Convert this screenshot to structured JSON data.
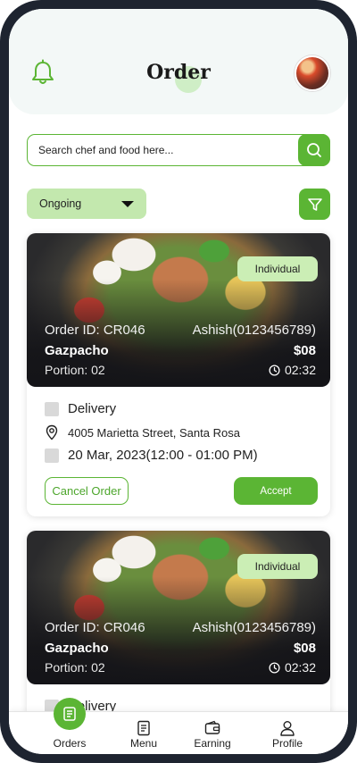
{
  "header": {
    "title": "Order",
    "icons": {
      "left": "bell-icon",
      "right": "avatar"
    }
  },
  "search": {
    "placeholder": "Search chef and food here...",
    "icon": "search-icon"
  },
  "filters": {
    "status_selected": "Ongoing",
    "filter_icon": "filter-icon"
  },
  "orders": [
    {
      "type": "Individual",
      "order_id": "Order ID: CR046",
      "customer": "Ashish(0123456789)",
      "dish": "Gazpacho",
      "price": "$08",
      "portion": "Portion: 02",
      "timer": "02:32",
      "delivery_label": "Delivery",
      "address": "4005 Marietta Street, Santa Rosa",
      "date": "20 Mar, 2023(12:00 - 01:00 PM)",
      "cancel_label": "Cancel Order",
      "accept_label": "Accept"
    },
    {
      "type": "Individual",
      "order_id": "Order ID: CR046",
      "customer": "Ashish(0123456789)",
      "dish": "Gazpacho",
      "price": "$08",
      "portion": "Portion: 02",
      "timer": "02:32",
      "delivery_label": "Delivery"
    }
  ],
  "nav": {
    "items": [
      {
        "label": "Orders",
        "icon": "orders-icon"
      },
      {
        "label": "Menu",
        "icon": "menu-icon"
      },
      {
        "label": "Earning",
        "icon": "wallet-icon"
      },
      {
        "label": "Profile",
        "icon": "profile-icon"
      }
    ],
    "active": "Orders"
  },
  "colors": {
    "accent": "#5bb534",
    "accent_light": "#c3e8ae",
    "badge": "#cbeeb5",
    "frame": "#1e2430"
  }
}
